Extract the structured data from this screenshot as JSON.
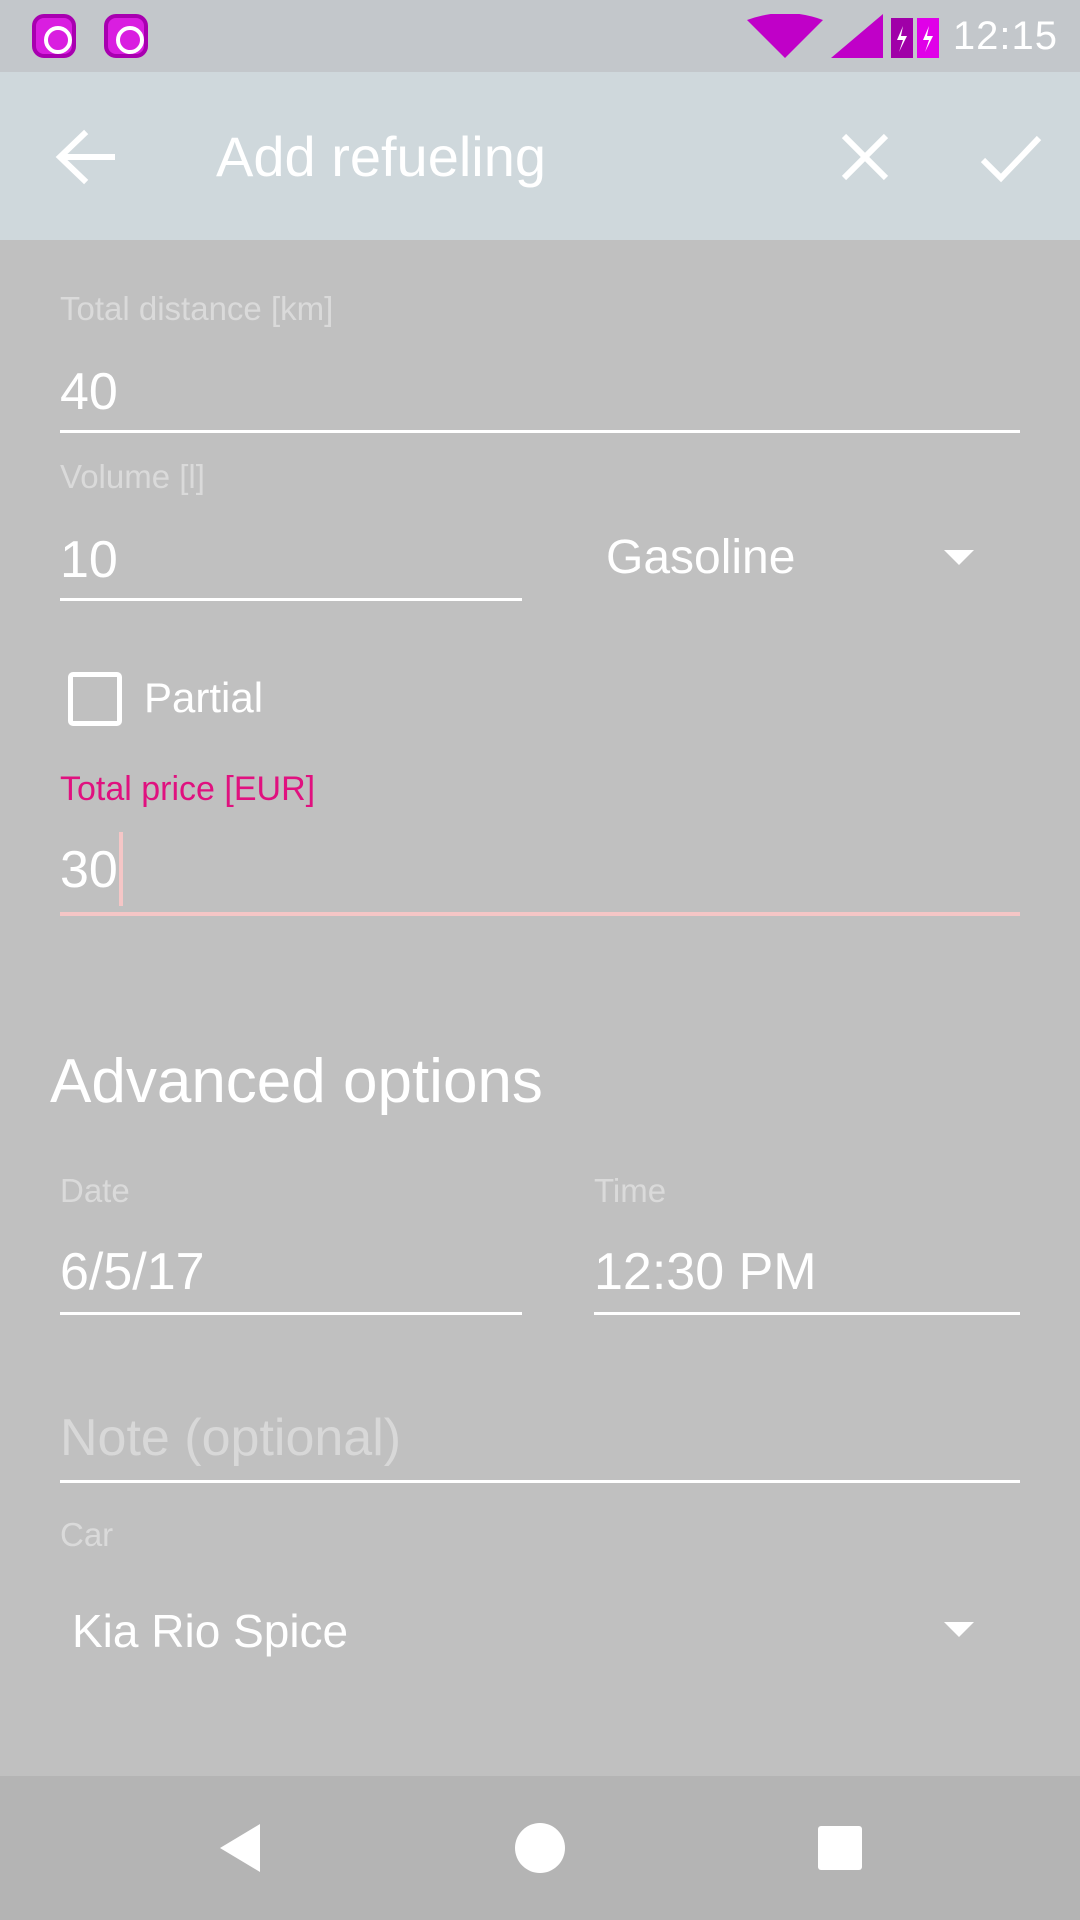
{
  "status_bar": {
    "time": "12:15"
  },
  "app_bar": {
    "title": "Add refueling"
  },
  "form": {
    "distance": {
      "label": "Total distance [km]",
      "value": "40"
    },
    "volume": {
      "label": "Volume [l]",
      "value": "10"
    },
    "fuel_type": {
      "selected": "Gasoline"
    },
    "partial": {
      "label": "Partial",
      "checked": false
    },
    "price": {
      "label": "Total price [EUR]",
      "value": "30"
    },
    "advanced_title": "Advanced options",
    "date": {
      "label": "Date",
      "value": "6/5/17"
    },
    "time": {
      "label": "Time",
      "value": "12:30 PM"
    },
    "note": {
      "placeholder": "Note (optional)"
    },
    "car": {
      "label": "Car",
      "selected": "Kia Rio Spice"
    }
  },
  "colors": {
    "app_bar": "#cfd8dc",
    "background": "#c0c0c0",
    "accent": "#f5c6c6",
    "nav_bar": "#b4b4b4"
  }
}
